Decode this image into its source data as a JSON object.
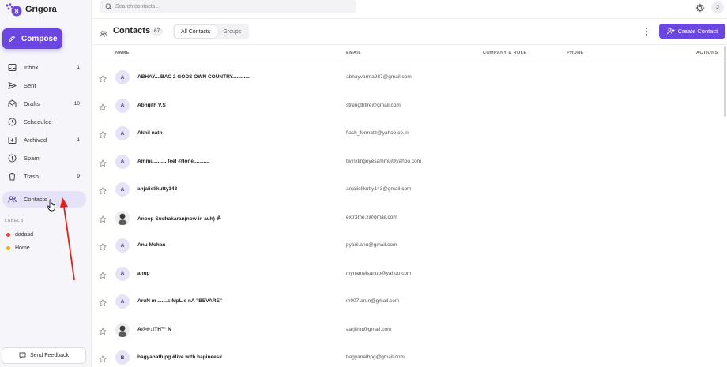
{
  "app": {
    "name": "Grigora",
    "brand_color": "#6c46e0"
  },
  "sidebar": {
    "compose_label": "Compose",
    "items": [
      {
        "label": "Inbox",
        "count": "1",
        "icon": "inbox-icon"
      },
      {
        "label": "Sent",
        "count": "",
        "icon": "send-icon"
      },
      {
        "label": "Drafts",
        "count": "10",
        "icon": "drafts-icon"
      },
      {
        "label": "Scheduled",
        "count": "",
        "icon": "clock-icon"
      },
      {
        "label": "Archived",
        "count": "1",
        "icon": "archive-icon"
      },
      {
        "label": "Spam",
        "count": "",
        "icon": "spam-icon"
      },
      {
        "label": "Trash",
        "count": "9",
        "icon": "trash-icon"
      },
      {
        "label": "Contacts",
        "count": "",
        "icon": "contacts-icon",
        "active": true
      }
    ],
    "labels_title": "LABELS",
    "labels": [
      {
        "name": "dadasd",
        "color": "#e0403a"
      },
      {
        "name": "Home",
        "color": "#e6a817"
      }
    ],
    "feedback_label": "Send Feedback"
  },
  "topbar": {
    "search_placeholder": "Search contacts...",
    "user_initial": "J"
  },
  "header": {
    "title": "Contacts",
    "count": "67",
    "tabs": [
      "All Contacts",
      "Groups"
    ],
    "active_tab": "All Contacts",
    "create_label": "Create Contact"
  },
  "table": {
    "columns": {
      "name": "NAME",
      "email": "EMAIL",
      "company": "COMPANY & ROLE",
      "phone": "PHONE",
      "actions": "ACTIONS"
    },
    "rows": [
      {
        "initial": "A",
        "name": "ABHAY....BAC 2 GODS OWN COUNTRY............",
        "email": "abhayvarma987@gmail.com"
      },
      {
        "initial": "A",
        "name": "Abhijith V.S",
        "email": "strengthfire@gmail.com"
      },
      {
        "initial": "A",
        "name": "Akhil nath",
        "email": "flash_formatz@yahoo.co.in"
      },
      {
        "initial": "A",
        "name": "Ammu.... .... feel @lone...........",
        "email": "twinklingeyesammu@yahoo.com"
      },
      {
        "initial": "A",
        "name": "anjalielikutty143",
        "email": "anjalielikutty143@gmail.com"
      },
      {
        "initial": "",
        "photo": true,
        "name": "Anoop Sudhakaran(now in auh) ॐ",
        "email": "extr3me.x@gmail.com"
      },
      {
        "initial": "A",
        "name": "Anu Mohan",
        "email": "pyarii.anu@gmail.com"
      },
      {
        "initial": "A",
        "name": "anup",
        "email": "mynameisanup@yahoo.com"
      },
      {
        "initial": "A",
        "name": "AruN m .......siMpLie nA \"BEVARE\"",
        "email": "m007.arun@gmail.com"
      },
      {
        "initial": "",
        "photo": true,
        "name": "A@®↓!TH™ N",
        "email": "aarjithn@gmail.com"
      },
      {
        "initial": "B",
        "name": "bagyanath pg #live with hapinees#",
        "email": "bagyanathpg@gmail.com"
      }
    ]
  }
}
